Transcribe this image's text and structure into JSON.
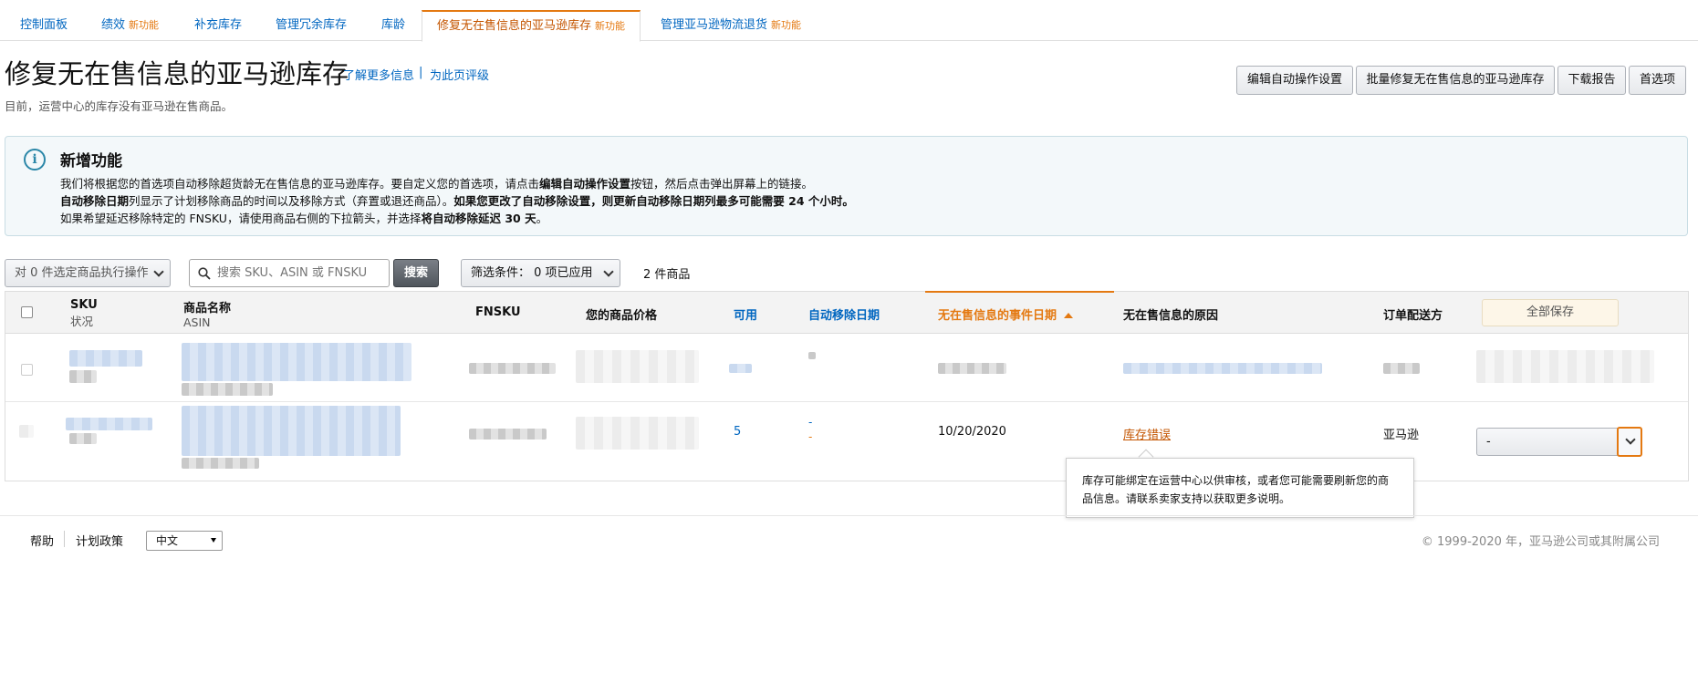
{
  "tabs": [
    {
      "label": "控制面板",
      "badge": ""
    },
    {
      "label": "绩效",
      "badge": "新功能"
    },
    {
      "label": "补充库存",
      "badge": ""
    },
    {
      "label": "管理冗余库存",
      "badge": ""
    },
    {
      "label": "库龄",
      "badge": ""
    },
    {
      "label": "修复无在售信息的亚马逊库存",
      "badge": "新功能"
    },
    {
      "label": "管理亚马逊物流退货",
      "badge": "新功能"
    }
  ],
  "header": {
    "title": "修复无在售信息的亚马逊库存",
    "learn_more": "了解更多信息",
    "separator": "|",
    "rate_page": "为此页评级",
    "subtitle": "目前，运营中心的库存没有亚马逊在售商品。"
  },
  "actions": {
    "edit_auto": "编辑自动操作设置",
    "bulk_fix": "批量修复无在售信息的亚马逊库存",
    "download": "下载报告",
    "preferences": "首选项"
  },
  "info": {
    "title": "新增功能",
    "line1_a": "我们将根据您的首选项自动移除超货龄无在售信息的亚马逊库存。要自定义您的首选项，请点击",
    "line1_b": "编辑自动操作设置",
    "line1_c": "按钮，然后点击弹出屏幕上的链接。",
    "line2_a": "自动移除日期",
    "line2_b": "列显示了计划移除商品的时间以及移除方式（弃置或退还商品）。",
    "line2_c": "如果您更改了自动移除设置，则更新自动移除日期列最多可能需要 24 个小时。",
    "line3_a": "如果希望延迟移除特定的 FNSKU，请使用商品右侧的下拉箭头，并选择",
    "line3_b": "将自动移除延迟 30 天",
    "line3_c": "。"
  },
  "toolbar": {
    "bulk_action": "对 0 件选定商品执行操作",
    "search_placeholder": "搜索 SKU、ASIN 或 FNSKU",
    "search_button": "搜索",
    "filter": "筛选条件：  0 项已应用",
    "count": "2 件商品"
  },
  "table": {
    "headers": {
      "sku": "SKU",
      "status": "状况",
      "name": "商品名称",
      "asin": "ASIN",
      "fnsku": "FNSKU",
      "price": "您的商品价格",
      "available": "可用",
      "auto_remove": "自动移除日期",
      "event_date": "无在售信息的事件日期",
      "reason": "无在售信息的原因",
      "fulfillment": "订单配送方",
      "save_all": "全部保存"
    },
    "row2": {
      "available": "5",
      "auto_remove_1": "-",
      "auto_remove_2": "-",
      "event_date": "10/20/2020",
      "reason": "库存错误",
      "fulfillment": "亚马逊",
      "action": "-"
    }
  },
  "tooltip": {
    "text": "库存可能绑定在运营中心以供审核，或者您可能需要刷新您的商品信息。请联系卖家支持以获取更多说明。"
  },
  "footer": {
    "help": "帮助",
    "policy": "计划政策",
    "language": "中文",
    "copyright": "© 1999-2020 年，亚马逊公司或其附属公司"
  },
  "colors": {
    "link": "#0066c0",
    "accent": "#e47911",
    "info_bg": "#f3f8fa"
  }
}
